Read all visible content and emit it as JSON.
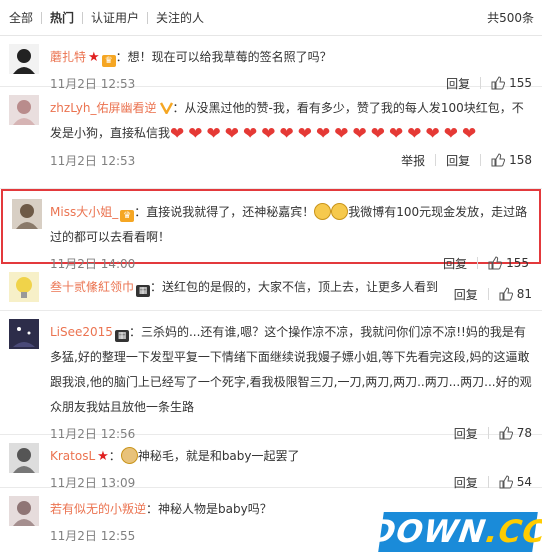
{
  "tabs": {
    "all": "全部",
    "hot": "热门",
    "verified": "认证用户",
    "following": "关注的人",
    "count": "共500条"
  },
  "actions": {
    "reply": "回复",
    "report": "举报"
  },
  "comments": [
    {
      "user": "蘑扎特",
      "text": "：想！现在可以给我草莓的签名照了吗？",
      "time": "11月2日 12:53",
      "likes": "155",
      "avatar_color": "#2b2b2b"
    },
    {
      "user": "zhzLyh_佑屏幽看逆",
      "text": "：从没黑过他的赞-我，看有多少，赞了我的每人发100块红包，不发是小狗，直接私信我",
      "hearts": 17,
      "time": "11月2日 12:53",
      "likes": "158",
      "avatar_color": "#c9a7a7"
    },
    {
      "user": "Miss大小姐_",
      "text_a": "：直接说我就得了，还神秘嘉宾！",
      "text_b": "我微博有100元现金发放，走过路过的都可以去看看啊！",
      "time": "11月2日 14:00",
      "likes": "155",
      "avatar_color": "#8a7a6a"
    },
    {
      "user": "叁十贰絛紅领巾",
      "text": "：送红包的是假的，大家不信，顶上去，让更多人看到",
      "time": "",
      "likes": "81",
      "avatar_color": "#e8d56a"
    },
    {
      "user": "LiSee2015",
      "text": "：三杀妈的...还有谁,嗯？这个操作凉不凉，我就问你们凉不凉!!妈的我是有多猛,好的整理一下发型平复一下情绪下面继续说我嫚子嫖小姐,等下先看完这段,妈的这逼敢跟我浪,他的脑门上已经写了一个死字,看我极限智三刀,一刀,两刀,两刀..两刀...两刀...好的观众朋友我姑且放他一条生路",
      "time": "11月2日 12:56",
      "likes": "78",
      "avatar_color": "#2d2d4a"
    },
    {
      "user": "KratosL",
      "text": "神秘毛，就是和baby一起罢了",
      "time": "11月2日 13:09",
      "likes": "54",
      "avatar_color": "#6b6b6b"
    },
    {
      "user": "若有似无的小叛逆",
      "text": "：神秘人物是baby吗？",
      "time": "11月2日 12:55",
      "likes": "",
      "avatar_color": "#a58f8f"
    }
  ],
  "watermark": {
    "main": "DOWN",
    "suffix": ".CC"
  },
  "colors": {
    "username": "#eb7350",
    "highlight_border": "#e3393c",
    "watermark_bg": "#1a8bd9"
  }
}
